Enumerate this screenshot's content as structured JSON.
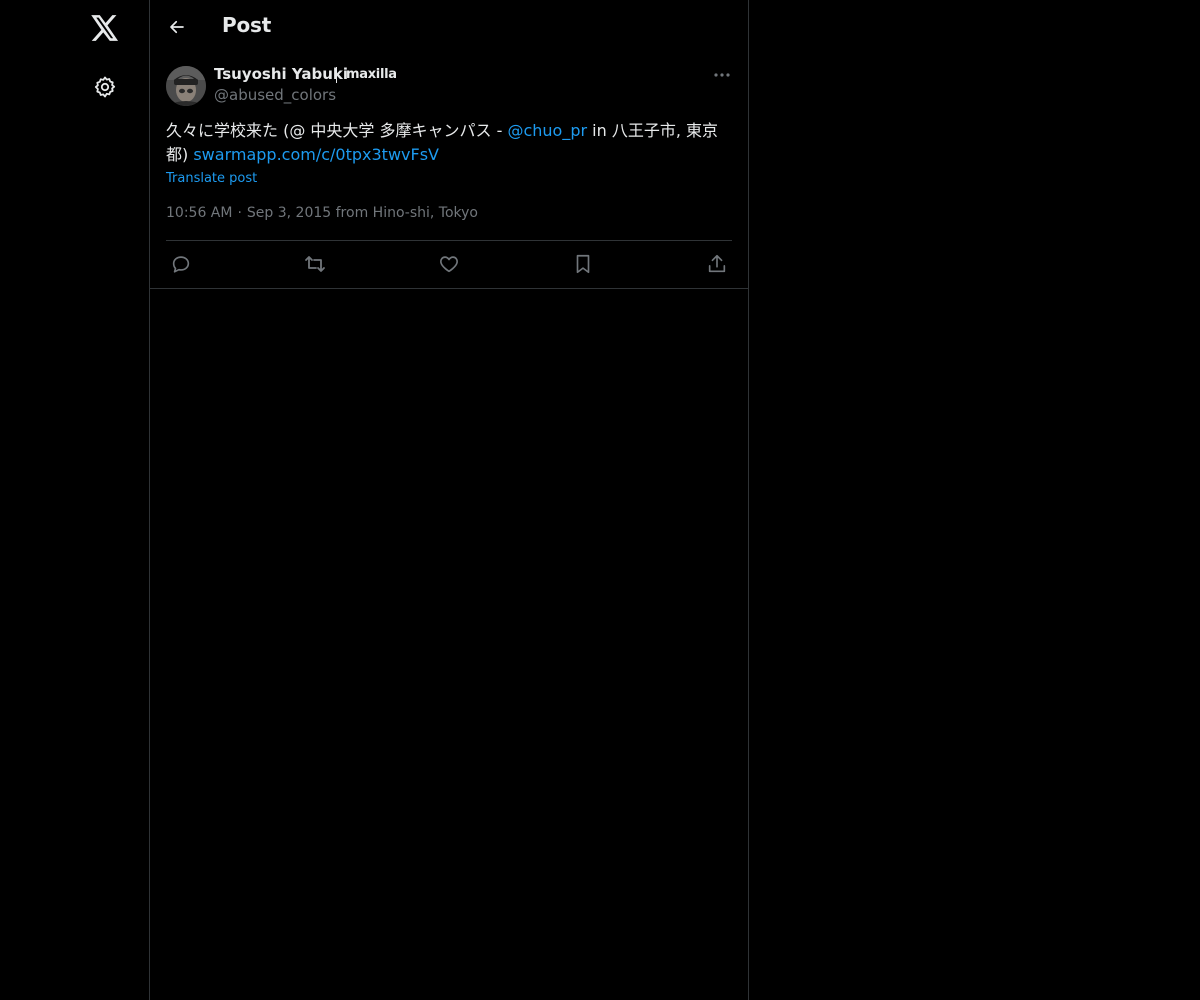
{
  "header": {
    "title": "Post",
    "back_icon": "arrow-left-icon"
  },
  "nav": {
    "logo_icon": "x-logo-icon",
    "settings_icon": "gear-icon"
  },
  "post": {
    "author": {
      "name": "Tsuyoshi Yabuki",
      "affiliation": "maxilla",
      "handle": "@abused_colors"
    },
    "text": {
      "part1": "久々に学校来た (@ 中央大学 多摩キャンパス - ",
      "mention": "@chuo_pr",
      "part2": " in 八王子市, 東京都) ",
      "link": "swarmapp.com/c/0tpx3twvFsV"
    },
    "translate_label": "Translate post",
    "time": "10:56 AM",
    "separator": "·",
    "date_location": "Sep 3, 2015 from Hino-shi, Tokyo"
  },
  "actions": [
    "reply-icon",
    "repost-icon",
    "like-icon",
    "bookmark-icon",
    "share-icon"
  ],
  "colors": {
    "background": "#000000",
    "text": "#e7e9ea",
    "muted": "#71767b",
    "link": "#1d9bf0",
    "border": "#2f3336"
  }
}
